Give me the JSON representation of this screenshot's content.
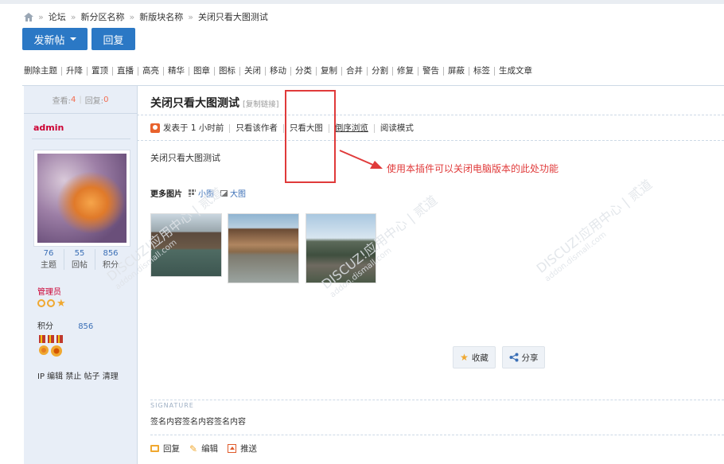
{
  "breadcrumb": {
    "home_icon": "home-icon",
    "items": [
      "论坛",
      "新分区名称",
      "新版块名称",
      "关闭只看大图测试"
    ],
    "separator": "»"
  },
  "toolbar": {
    "new_post_label": "发新帖",
    "reply_label": "回复"
  },
  "mod_actions": [
    "删除主题",
    "升降",
    "置顶",
    "直播",
    "高亮",
    "精华",
    "图章",
    "图标",
    "关闭",
    "移动",
    "分类",
    "复制",
    "合并",
    "分割",
    "修复",
    "警告",
    "屏蔽",
    "标签",
    "生成文章"
  ],
  "thread_stats": {
    "views_label": "查看:",
    "views": "4",
    "replies_label": "回复:",
    "replies": "0"
  },
  "thread": {
    "title": "关闭只看大图测试",
    "copy_link": "[复制链接]"
  },
  "author": {
    "name": "admin",
    "stats": [
      {
        "value": "76",
        "label": "主题"
      },
      {
        "value": "55",
        "label": "回帖"
      },
      {
        "value": "856",
        "label": "积分"
      }
    ],
    "group": "管理员",
    "points_label": "积分",
    "points_value": "856",
    "admin_links": "IP 编辑 禁止 帖子 清理"
  },
  "post_meta": [
    "发表于 1 小时前",
    "只看该作者",
    "只看大图",
    "倒序浏览",
    "阅读模式"
  ],
  "post": {
    "content": "关闭只看大图测试",
    "more_images_label": "更多图片",
    "small_view": "小图",
    "large_view": "大图"
  },
  "annotation": {
    "text": "使用本插件可以关闭电脑版本的此处功能",
    "color": "#e03a3a"
  },
  "watermarks": [
    {
      "main": "DISCUZ!应用中心 | 贰道",
      "sub": "addon.dismall.com"
    }
  ],
  "buttons": {
    "favorite": "收藏",
    "share": "分享"
  },
  "signature": {
    "label": "SIGNATURE",
    "text": "签名内容签名内容签名内容"
  },
  "post_actions": [
    "回复",
    "编辑",
    "推送"
  ],
  "colors": {
    "primary": "#2b78c5",
    "author": "#cc0033",
    "accent": "#f0a830",
    "sidebar_bg": "#e8eef7"
  }
}
